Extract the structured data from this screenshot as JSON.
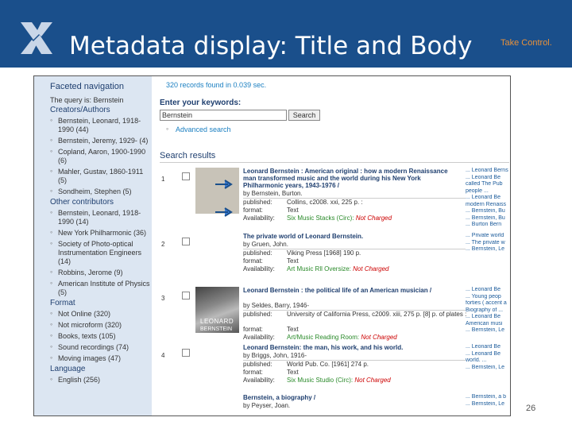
{
  "slide": {
    "title": "Metadata display: Title and Body",
    "tagline": "Take Control.",
    "page_number": "26",
    "colors": {
      "header": "#1a4f8b",
      "tagline": "#e8913a",
      "accent_link": "#1a7fc1",
      "facet_bg": "#dce6f2"
    }
  },
  "facets": {
    "title": "Faceted navigation",
    "query": "The query is: Bernstein",
    "sections": [
      {
        "label": "Creators/Authors",
        "items": [
          "Bernstein, Leonard, 1918-1990 (44)",
          "Bernstein, Jeremy, 1929- (4)",
          "Copland, Aaron, 1900-1990 (6)",
          "Mahler, Gustav, 1860-1911 (5)",
          "Sondheim, Stephen (5)"
        ]
      },
      {
        "label": "Other contributors",
        "items": [
          "Bernstein, Leonard, 1918-1990 (14)",
          "New York Philharmonic (36)",
          "Society of Photo-optical Instrumentation Engineers (14)",
          "Robbins, Jerome (9)",
          "American Institute of Physics (5)"
        ]
      },
      {
        "label": "Format",
        "items": [
          "Not Online (320)",
          "Not microform (320)",
          "Books, texts (105)",
          "Sound recordings (74)",
          "Moving images (47)"
        ]
      },
      {
        "label": "Language",
        "items": [
          "English (256)"
        ]
      }
    ]
  },
  "search": {
    "records_found": "320 records found in 0.039 sec.",
    "keywords_label": "Enter your keywords:",
    "keywords_value": "Bernstein",
    "button_label": "Search",
    "advanced_label": "Advanced search",
    "results_title": "Search results"
  },
  "results": [
    {
      "num": "1",
      "title": "Leonard Bernstein : American original : how a modern Renaissance man transformed music and the world during his New York Philharmonic years, 1943-1976 /",
      "by": "by Bernstein, Burton.",
      "published": "Collins, c2008. xxi, 225 p. :",
      "format": "Text",
      "availability": "Six Music Stacks (Circ):",
      "availability_status": "Not Charged",
      "side": [
        "... Leonard Berns",
        "... Leonard Be",
        "called The Pub",
        "people ...",
        "... Leonard Be",
        "modern Renaiss",
        "... Bernstein, Bu",
        "... Bernstein, Bu",
        "... Burton Bern"
      ],
      "has_thumb": true
    },
    {
      "num": "2",
      "title": "The private world of Leonard Bernstein.",
      "by": "by Gruen, John.",
      "published": "Viking Press [1968] 190 p.",
      "format": "Text",
      "availability": "Art Music Rll Oversize:",
      "availability_status": "Not Charged",
      "side": [
        "... Private world",
        "... The private w",
        "... Bernstein, Le"
      ],
      "has_thumb": false
    },
    {
      "num": "3",
      "title": "Leonard Bernstein : the political life of an American musician /",
      "by": "by Seldes, Barry, 1946-",
      "published": "University of California Press, c2009. xiii, 275 p. [8] p. of plates :",
      "format": "Text",
      "availability": "Art/Music Reading Room:",
      "availability_status": "Not Charged",
      "side": [
        "... Leonard Be",
        "... Young peop",
        "forties ( accent a",
        "Biography of ...",
        "... Leonard Be",
        "American musi",
        "... Bernstein, Le"
      ],
      "has_thumb": true,
      "thumb_text": "LEONARD",
      "thumb_text2": "BERNSTEIN"
    },
    {
      "num": "4",
      "title": "Leonard Bernstein: the man, his work, and his world.",
      "by": "by Briggs, John, 1916-",
      "published": "World Pub. Co. [1961] 274 p.",
      "format": "Text",
      "availability": "Six Music Studio (Circ):",
      "availability_status": "Not Charged",
      "side": [
        "... Leonard Be",
        "... Leonard Be",
        "world. ...",
        "... Bernstein, Le"
      ],
      "has_thumb": false
    },
    {
      "num": "",
      "title": "Bernstein, a biography /",
      "by": "by Peyser, Joan.",
      "side": [
        "... Bernstein, a b",
        "... Bernstein, Le"
      ],
      "has_thumb": false
    }
  ],
  "field_labels": {
    "published": "published:",
    "format": "format:",
    "availability": "Availability:"
  }
}
